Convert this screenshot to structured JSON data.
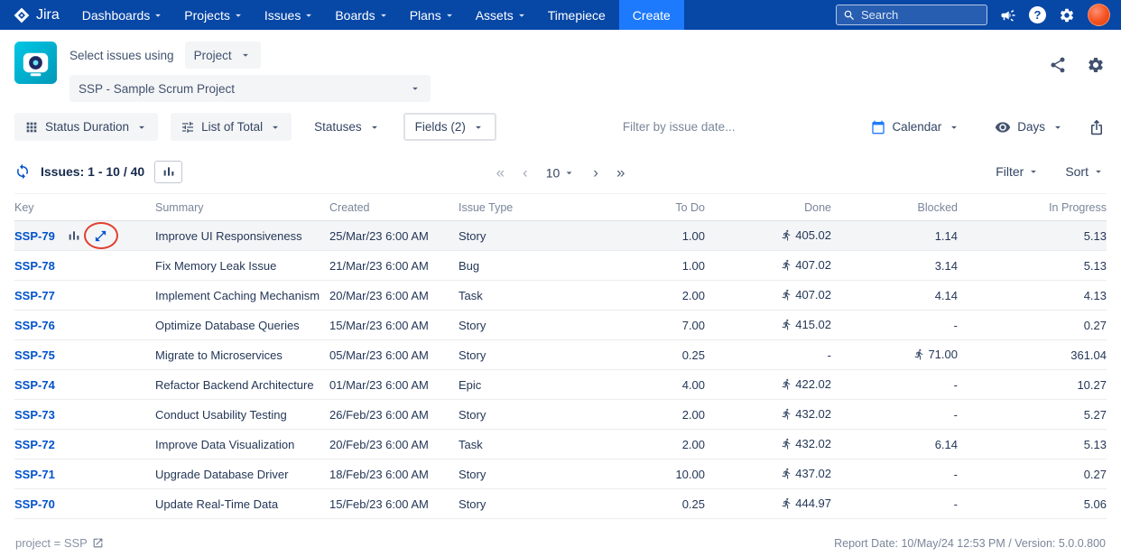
{
  "colors": {
    "nav_bg": "#0747A6",
    "create_bg": "#1D7AFC",
    "accent": "#0052CC",
    "app_icon_bg": "#00B8D9",
    "annotation_red": "#E0402F",
    "row_highlight": "#F4F5F7"
  },
  "nav": {
    "brand": "Jira",
    "items": [
      {
        "label": "Dashboards",
        "chevron": true
      },
      {
        "label": "Projects",
        "chevron": true
      },
      {
        "label": "Issues",
        "chevron": true
      },
      {
        "label": "Boards",
        "chevron": true
      },
      {
        "label": "Plans",
        "chevron": true
      },
      {
        "label": "Assets",
        "chevron": true
      },
      {
        "label": "Timepiece",
        "chevron": false
      }
    ],
    "create_label": "Create",
    "search_placeholder": "Search",
    "help_glyph": "?"
  },
  "header": {
    "select_label": "Select issues using",
    "mode_value": "Project",
    "project_value": "SSP - Sample Scrum Project"
  },
  "toolbar": {
    "report_type_label": "Status Duration",
    "view_mode_label": "List of Total",
    "statuses_label": "Statuses",
    "fields_label": "Fields (2)",
    "date_filter_placeholder": "Filter by issue date...",
    "calendar_label": "Calendar",
    "unit_label": "Days"
  },
  "list_controls": {
    "issues_label": "Issues: 1 - 10 / 40",
    "page_size": "10",
    "first_glyph": "«",
    "prev_glyph": "‹",
    "next_glyph": "›",
    "last_glyph": "»",
    "filter_label": "Filter",
    "sort_label": "Sort"
  },
  "table": {
    "columns": [
      {
        "label": "Key",
        "align": "left"
      },
      {
        "label": "Summary",
        "align": "left"
      },
      {
        "label": "Created",
        "align": "left"
      },
      {
        "label": "Issue Type",
        "align": "left"
      },
      {
        "label": "To Do",
        "align": "right"
      },
      {
        "label": "Done",
        "align": "right"
      },
      {
        "label": "Blocked",
        "align": "right"
      },
      {
        "label": "In Progress",
        "align": "right"
      }
    ],
    "rows": [
      {
        "key": "SSP-79",
        "summary": "Improve UI Responsiveness",
        "created": "25/Mar/23 6:00 AM",
        "issue_type": "Story",
        "to_do": "1.00",
        "done": "405.02",
        "done_runner": true,
        "blocked": "1.14",
        "blocked_runner": false,
        "in_progress": "5.13",
        "selected": true,
        "row_icons": true,
        "annotated": true
      },
      {
        "key": "SSP-78",
        "summary": "Fix Memory Leak Issue",
        "created": "21/Mar/23 6:00 AM",
        "issue_type": "Bug",
        "to_do": "1.00",
        "done": "407.02",
        "done_runner": true,
        "blocked": "3.14",
        "blocked_runner": false,
        "in_progress": "5.13",
        "selected": false,
        "row_icons": false,
        "annotated": false
      },
      {
        "key": "SSP-77",
        "summary": "Implement Caching Mechanism",
        "created": "20/Mar/23 6:00 AM",
        "issue_type": "Task",
        "to_do": "2.00",
        "done": "407.02",
        "done_runner": true,
        "blocked": "4.14",
        "blocked_runner": false,
        "in_progress": "4.13",
        "selected": false,
        "row_icons": false,
        "annotated": false
      },
      {
        "key": "SSP-76",
        "summary": "Optimize Database Queries",
        "created": "15/Mar/23 6:00 AM",
        "issue_type": "Story",
        "to_do": "7.00",
        "done": "415.02",
        "done_runner": true,
        "blocked": "-",
        "blocked_runner": false,
        "in_progress": "0.27",
        "selected": false,
        "row_icons": false,
        "annotated": false
      },
      {
        "key": "SSP-75",
        "summary": "Migrate to Microservices",
        "created": "05/Mar/23 6:00 AM",
        "issue_type": "Story",
        "to_do": "0.25",
        "done": "-",
        "done_runner": false,
        "blocked": "71.00",
        "blocked_runner": true,
        "in_progress": "361.04",
        "selected": false,
        "row_icons": false,
        "annotated": false
      },
      {
        "key": "SSP-74",
        "summary": "Refactor Backend Architecture",
        "created": "01/Mar/23 6:00 AM",
        "issue_type": "Epic",
        "to_do": "4.00",
        "done": "422.02",
        "done_runner": true,
        "blocked": "-",
        "blocked_runner": false,
        "in_progress": "10.27",
        "selected": false,
        "row_icons": false,
        "annotated": false
      },
      {
        "key": "SSP-73",
        "summary": "Conduct Usability Testing",
        "created": "26/Feb/23 6:00 AM",
        "issue_type": "Story",
        "to_do": "2.00",
        "done": "432.02",
        "done_runner": true,
        "blocked": "-",
        "blocked_runner": false,
        "in_progress": "5.27",
        "selected": false,
        "row_icons": false,
        "annotated": false
      },
      {
        "key": "SSP-72",
        "summary": "Improve Data Visualization",
        "created": "20/Feb/23 6:00 AM",
        "issue_type": "Task",
        "to_do": "2.00",
        "done": "432.02",
        "done_runner": true,
        "blocked": "6.14",
        "blocked_runner": false,
        "in_progress": "5.13",
        "selected": false,
        "row_icons": false,
        "annotated": false
      },
      {
        "key": "SSP-71",
        "summary": "Upgrade Database Driver",
        "created": "18/Feb/23 6:00 AM",
        "issue_type": "Story",
        "to_do": "10.00",
        "done": "437.02",
        "done_runner": true,
        "blocked": "-",
        "blocked_runner": false,
        "in_progress": "0.27",
        "selected": false,
        "row_icons": false,
        "annotated": false
      },
      {
        "key": "SSP-70",
        "summary": "Update Real-Time Data",
        "created": "15/Feb/23 6:00 AM",
        "issue_type": "Story",
        "to_do": "0.25",
        "done": "444.97",
        "done_runner": true,
        "blocked": "-",
        "blocked_runner": false,
        "in_progress": "5.06",
        "selected": false,
        "row_icons": false,
        "annotated": false
      }
    ]
  },
  "footer": {
    "left_text": "project = SSP",
    "right_text": "Report Date: 10/May/24 12:53 PM / Version: 5.0.0.800"
  },
  "icons": [
    "jira-logo-icon",
    "chevron-down-icon",
    "search-icon",
    "announcement-icon",
    "help-icon",
    "settings-gear-icon",
    "avatar",
    "app-logo-icon",
    "share-icon",
    "grid-icon",
    "sliders-icon",
    "calendar-icon",
    "eye-icon",
    "export-icon",
    "refresh-icon",
    "bar-chart-icon",
    "expand-icon",
    "runner-icon",
    "external-link-icon"
  ]
}
